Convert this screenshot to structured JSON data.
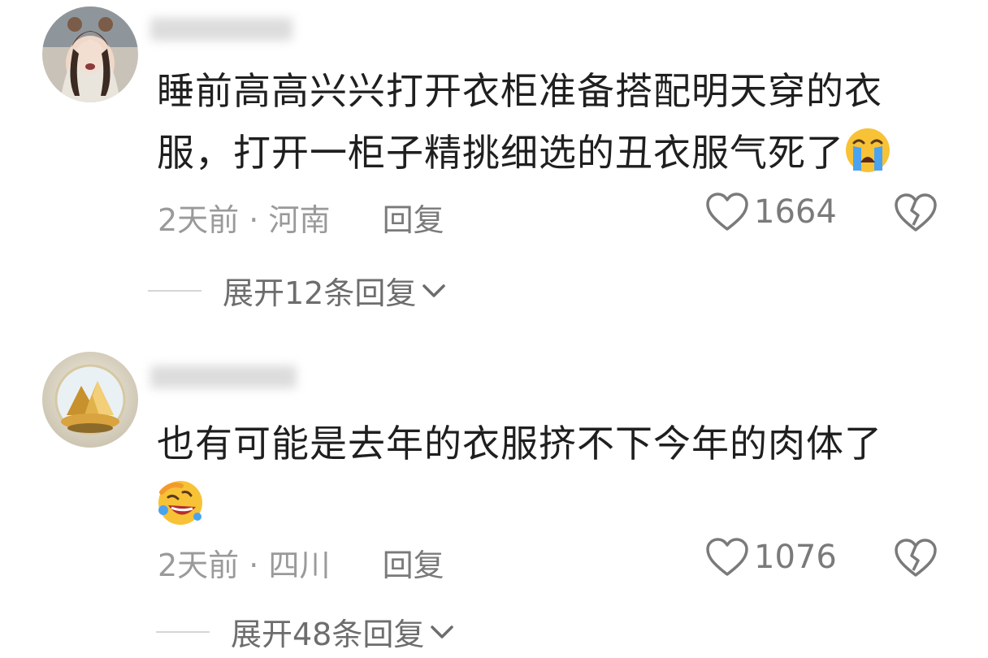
{
  "comments": [
    {
      "text": "睡前高高兴兴打开衣柜准备搭配明天穿的衣服，打开一柜子精挑细选的丑衣服气死了",
      "emoji": "loudly-crying-face",
      "time": "2天前",
      "separator": "·",
      "location": "河南",
      "reply_label": "回复",
      "likes": "1664",
      "expand_label": "展开12条回复"
    },
    {
      "text": "也有可能是去年的衣服挤不下今年的肉体了",
      "emoji": "rolling-on-floor-laughing",
      "time": "2天前",
      "separator": "·",
      "location": "四川",
      "reply_label": "回复",
      "likes": "1076",
      "expand_label": "展开48条回复"
    }
  ],
  "colors": {
    "text": "#1f1f1f",
    "meta": "#9a9a9a",
    "icon": "#7a7a7a",
    "emoji_yellow": "#f7c236",
    "emoji_tear": "#4aa3f0"
  }
}
